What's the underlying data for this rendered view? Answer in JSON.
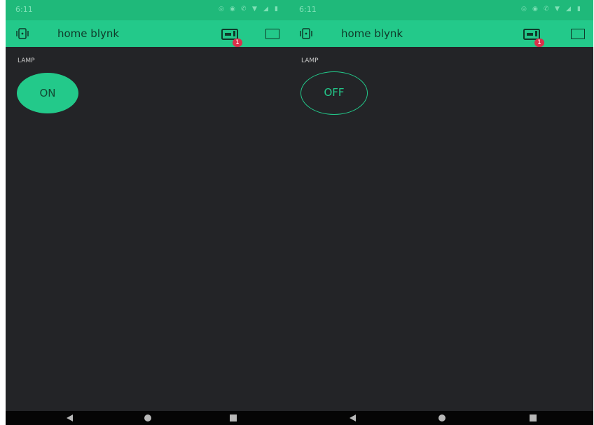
{
  "screens": [
    {
      "status_time": "6:11",
      "app_title": "home blynk",
      "notification_count": "1",
      "widget_label": "LAMP",
      "button_label": "ON",
      "button_state": "on"
    },
    {
      "status_time": "6:11",
      "app_title": "home blynk",
      "notification_count": "1",
      "widget_label": "LAMP",
      "button_label": "OFF",
      "button_state": "off"
    }
  ],
  "colors": {
    "accent": "#23c98a",
    "status_bar": "#1fb97a",
    "background": "#232427",
    "badge": "#d9314b"
  },
  "icons": [
    "device-icon",
    "notification-icon",
    "square-icon",
    "back-icon",
    "home-icon",
    "recent-apps-icon"
  ]
}
